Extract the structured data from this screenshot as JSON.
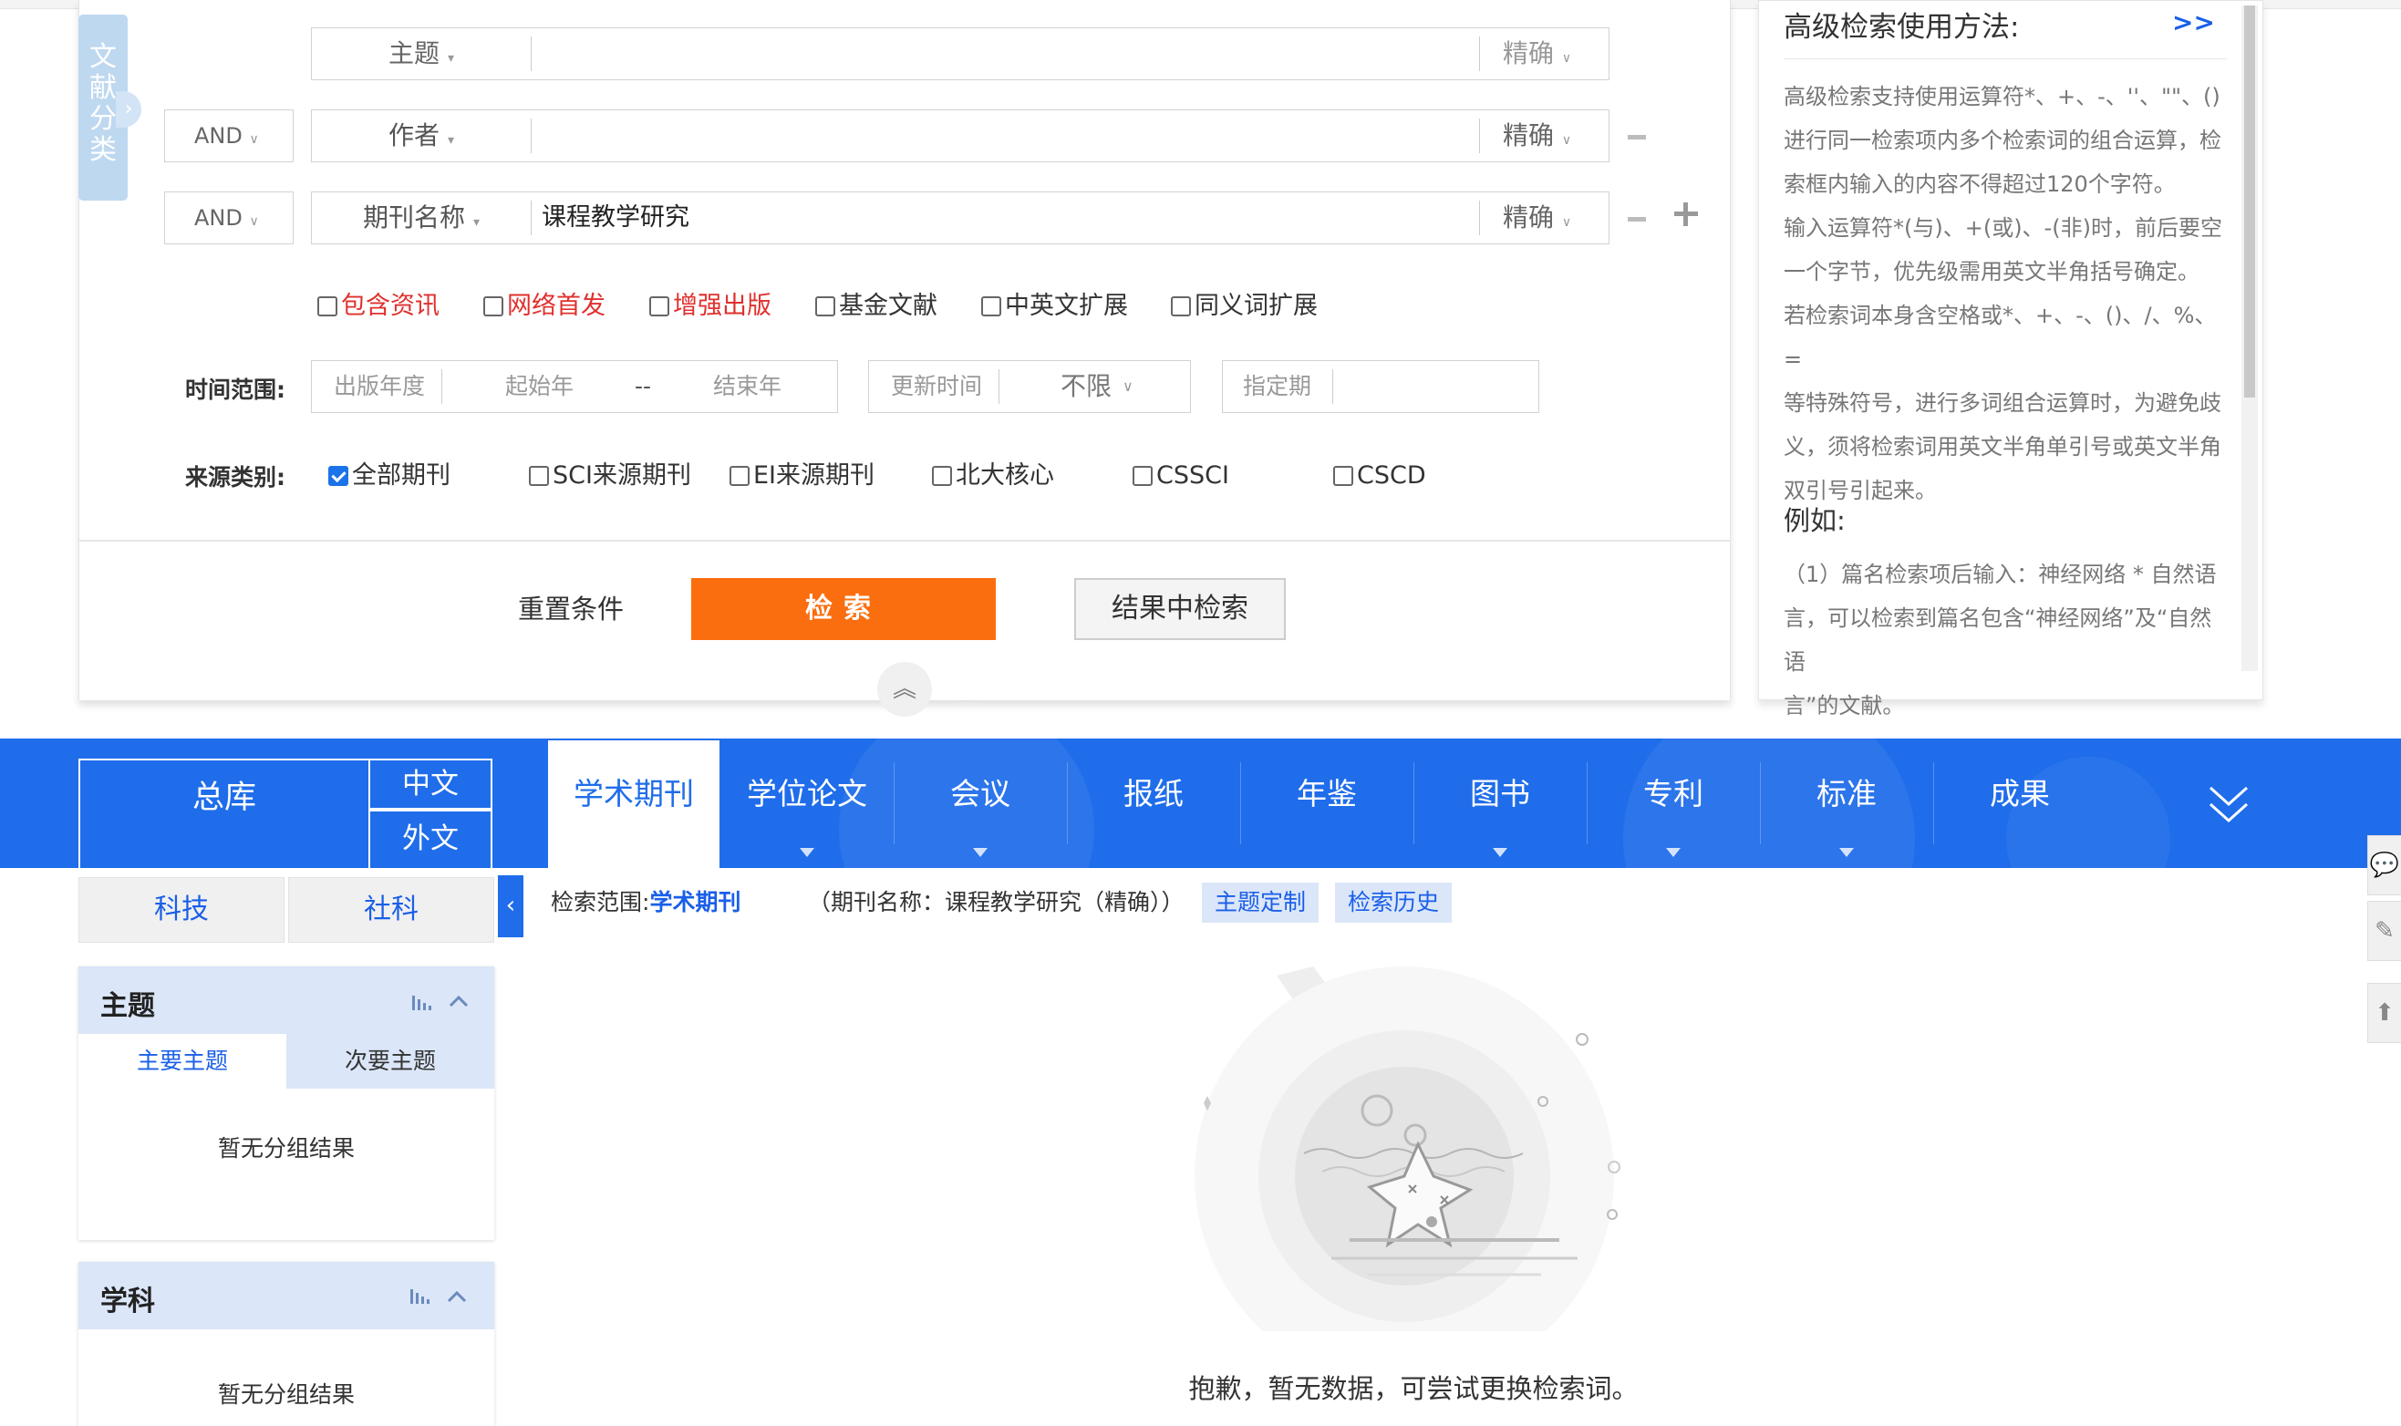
{
  "category_tab": {
    "label": "文献分类"
  },
  "search_rows": [
    {
      "field": "主题",
      "value": "",
      "match": "精确"
    },
    {
      "logic": "AND",
      "field": "作者",
      "value": "",
      "match": "精确"
    },
    {
      "logic": "AND",
      "field": "期刊名称",
      "value": "课程教学研究",
      "match": "精确"
    }
  ],
  "options": [
    {
      "label": "包含资讯",
      "checked": false,
      "red": true
    },
    {
      "label": "网络首发",
      "checked": false,
      "red": true
    },
    {
      "label": "增强出版",
      "checked": false,
      "red": true
    },
    {
      "label": "基金文献",
      "checked": false,
      "red": false
    },
    {
      "label": "中英文扩展",
      "checked": false,
      "red": false
    },
    {
      "label": "同义词扩展",
      "checked": false,
      "red": false
    }
  ],
  "time_range": {
    "label": "时间范围:",
    "pub_year_label": "出版年度",
    "start_placeholder": "起始年",
    "dash": "--",
    "end_placeholder": "结束年",
    "update_label": "更新时间",
    "update_value": "不限",
    "period_label": "指定期"
  },
  "source": {
    "label": "来源类别:",
    "items": [
      {
        "label": "全部期刊",
        "checked": true
      },
      {
        "label": "SCI来源期刊",
        "checked": false
      },
      {
        "label": "EI来源期刊",
        "checked": false
      },
      {
        "label": "北大核心",
        "checked": false
      },
      {
        "label": "CSSCI",
        "checked": false
      },
      {
        "label": "CSCD",
        "checked": false
      }
    ]
  },
  "actions": {
    "reset": "重置条件",
    "search": "检索",
    "in_results": "结果中检索"
  },
  "help": {
    "title": "高级检索使用方法:",
    "more": ">>",
    "lines": [
      "高级检索支持使用运算符*、+、-、''、\"\"、()",
      "进行同一检索项内多个检索词的组合运算，检",
      "索框内输入的内容不得超过120个字符。",
      "输入运算符*(与)、+(或)、-(非)时，前后要空",
      "一个字节，优先级需用英文半角括号确定。",
      "若检索词本身含空格或*、+、-、()、/、%、=",
      "等特殊符号，进行多词组合运算时，为避免歧",
      "义，须将检索词用英文半角单引号或英文半角",
      "双引号引起来。"
    ],
    "example_title": "例如:",
    "example_lines": [
      "（1）篇名检索项后输入：神经网络 * 自然语",
      "言，可以检索到篇名包含“神经网络”及“自然语",
      "言”的文献。"
    ]
  },
  "nav": {
    "zongku": "总库",
    "zh": "中文",
    "en": "外文",
    "items": [
      "学术期刊",
      "学位论文",
      "会议",
      "报纸",
      "年鉴",
      "图书",
      "专利",
      "标准",
      "成果"
    ],
    "active": "学术期刊"
  },
  "sidebar": {
    "segments": [
      "科技",
      "社科"
    ],
    "groups": [
      {
        "title": "主题",
        "tabs": [
          "主要主题",
          "次要主题"
        ],
        "empty": "暂无分组结果"
      },
      {
        "title": "学科",
        "empty": "暂无分组结果"
      }
    ]
  },
  "results": {
    "scope_label": "检索范围:",
    "scope_value": "学术期刊",
    "condition": "（期刊名称：课程教学研究（精确））",
    "chips": [
      "主题定制",
      "检索历史"
    ],
    "empty_message": "抱歉，暂无数据，可尝试更换检索词。"
  }
}
